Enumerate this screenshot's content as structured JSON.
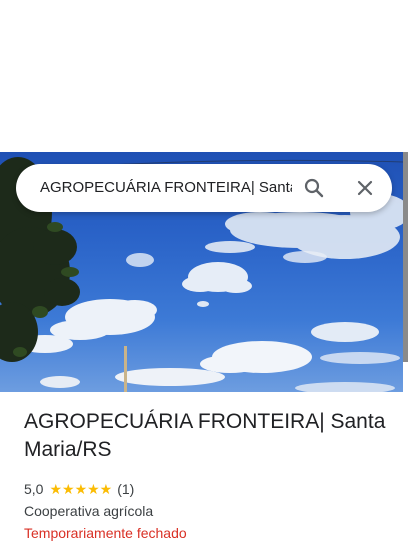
{
  "search": {
    "query": "AGROPECUÁRIA FRONTEIRA| Santa"
  },
  "place": {
    "name": "AGROPECUÁRIA FRONTEIRA| Santa Maria/RS",
    "rating": "5,0",
    "stars": "★★★★★",
    "review_count": "(1)",
    "category": "Cooperativa agrícola",
    "status": "Temporariamente fechado"
  },
  "colors": {
    "star": "#fbbc04",
    "status_closed": "#d93025",
    "text": "#202124"
  },
  "icons": {
    "search": "search-icon",
    "close": "close-icon"
  }
}
